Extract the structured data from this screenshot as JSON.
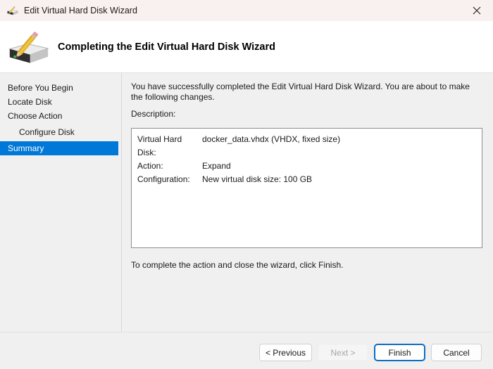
{
  "window": {
    "title": "Edit Virtual Hard Disk Wizard"
  },
  "header": {
    "title": "Completing the Edit Virtual Hard Disk Wizard"
  },
  "sidebar": {
    "items": [
      {
        "label": "Before You Begin",
        "selected": false
      },
      {
        "label": "Locate Disk",
        "selected": false
      },
      {
        "label": "Choose Action",
        "selected": false
      },
      {
        "label": "Configure Disk",
        "selected": false,
        "indent": true
      },
      {
        "label": "Summary",
        "selected": true
      }
    ]
  },
  "main": {
    "intro": "You have successfully completed the Edit Virtual Hard Disk Wizard. You are about to make the following changes.",
    "description_label": "Description:",
    "description_rows": [
      {
        "label": "Virtual Hard Disk:",
        "value": "docker_data.vhdx (VHDX, fixed size)"
      },
      {
        "label": "Action:",
        "value": "Expand"
      },
      {
        "label": "Configuration:",
        "value": "New virtual disk size: 100 GB"
      }
    ],
    "footer_note": "To complete the action and close the wizard, click Finish."
  },
  "buttons": {
    "previous": "< Previous",
    "next": "Next >",
    "finish": "Finish",
    "cancel": "Cancel"
  },
  "colors": {
    "accent": "#0078d7",
    "finish_border": "#0f6cbe",
    "titlebar_bg": "#f9f1ef",
    "body_bg": "#f0f0f0"
  }
}
